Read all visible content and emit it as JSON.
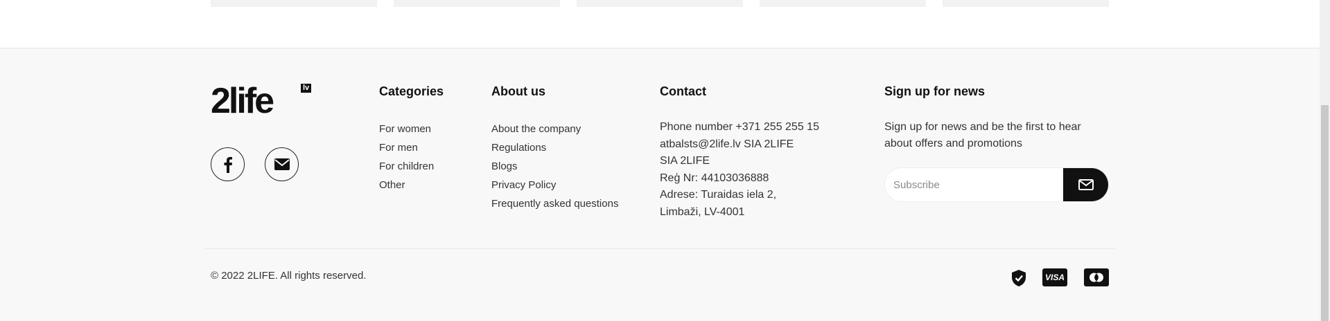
{
  "brand": {
    "logo_text": "2life",
    "logo_badge": "lv"
  },
  "columns": {
    "categories": {
      "title": "Categories",
      "items": [
        "For women",
        "For men",
        "For children",
        "Other"
      ]
    },
    "about": {
      "title": "About us",
      "items": [
        "About the company",
        "Regulations",
        "Blogs",
        "Privacy Policy",
        "Frequently asked questions"
      ]
    },
    "contact": {
      "title": "Contact",
      "lines": [
        "Phone number +371 255 255 15",
        "atbalsts@2life.lv SIA 2LIFE",
        "SIA 2LIFE",
        "Reģ Nr: 44103036888",
        "Adrese: Turaidas iela 2,",
        "Limbaži, LV-4001"
      ]
    },
    "newsletter": {
      "title": "Sign up for news",
      "text": "Sign up for news and be the first to hear about offers and promotions",
      "placeholder": "Subscribe"
    }
  },
  "social": [
    "facebook-icon",
    "email-icon"
  ],
  "copyright": "© 2022 2LIFE. All rights reserved.",
  "payments": [
    "shield-check-icon",
    "visa-icon",
    "mastercard-icon"
  ],
  "payment_labels": {
    "visa": "VISA"
  },
  "colors": {
    "background": "#f8f8f8",
    "text": "#222222",
    "accent": "#111111"
  }
}
